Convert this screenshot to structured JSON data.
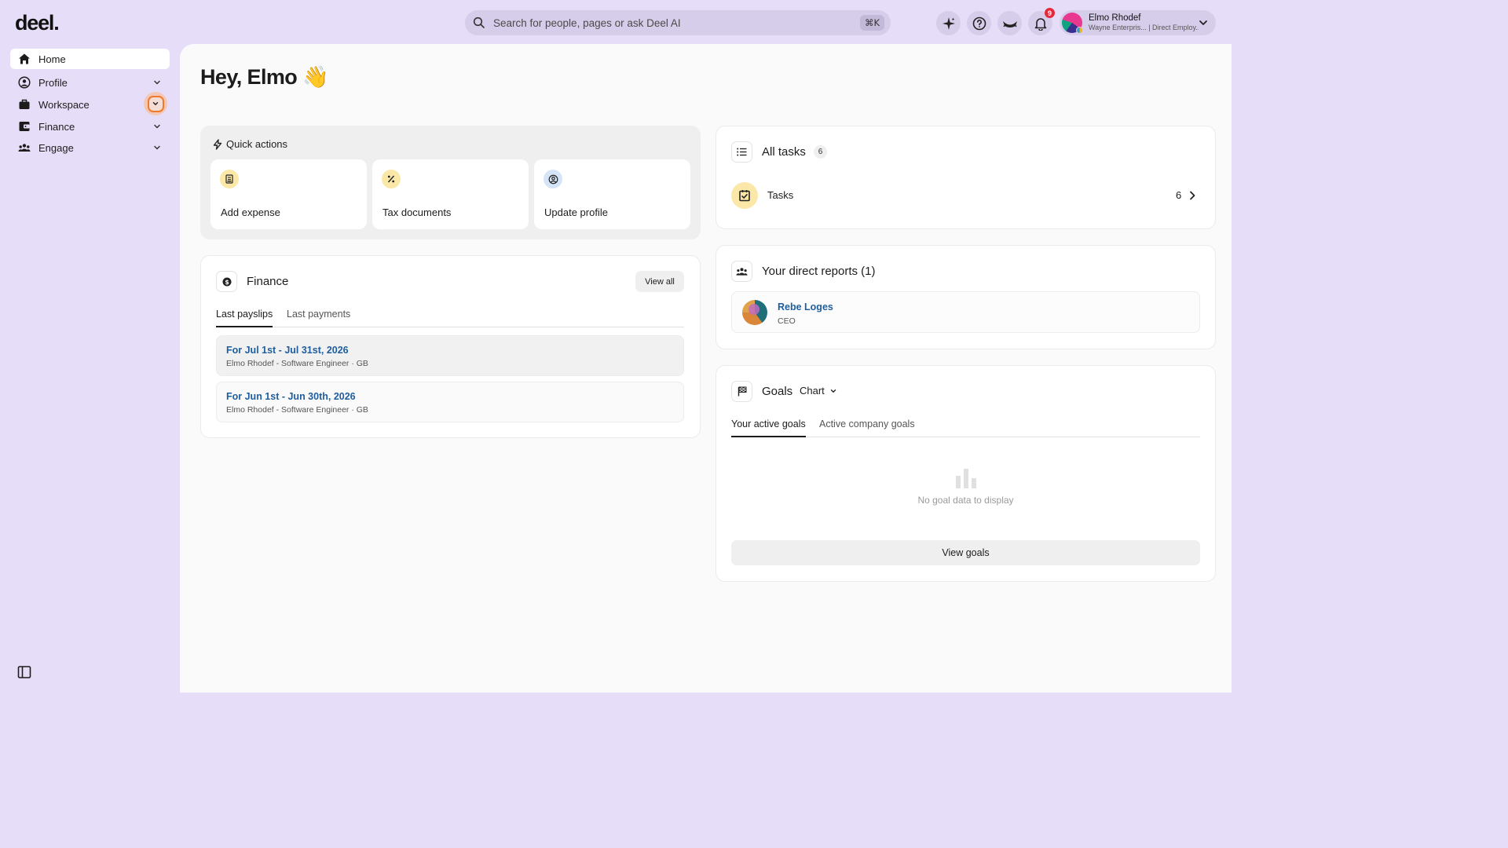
{
  "app": {
    "logo": "deel."
  },
  "search": {
    "placeholder": "Search for people, pages or ask Deel AI",
    "shortcut": "⌘K"
  },
  "topbar": {
    "notification_count": "9"
  },
  "user": {
    "name": "Elmo Rhodef",
    "subtitle": "Wayne Enterpris... | Direct Employ..."
  },
  "sidebar": {
    "items": [
      {
        "label": "Home",
        "icon": "home-icon",
        "active": true
      },
      {
        "label": "Profile",
        "icon": "user-circle-icon"
      },
      {
        "label": "Workspace",
        "icon": "briefcase-icon"
      },
      {
        "label": "Finance",
        "icon": "wallet-icon"
      },
      {
        "label": "Engage",
        "icon": "people-icon"
      }
    ]
  },
  "main": {
    "greeting": "Hey, Elmo",
    "wave": "👋"
  },
  "quick_actions": {
    "title": "Quick actions",
    "items": [
      {
        "label": "Add expense",
        "icon": "receipt-icon",
        "color": "#fbe7a8"
      },
      {
        "label": "Tax documents",
        "icon": "percent-icon",
        "color": "#fbe7a8"
      },
      {
        "label": "Update profile",
        "icon": "user-circle-icon",
        "color": "#d5e4f7"
      }
    ]
  },
  "finance": {
    "title": "Finance",
    "view_all": "View all",
    "tabs": [
      "Last payslips",
      "Last payments"
    ],
    "payslips": [
      {
        "title": "For Jul 1st - Jul 31st, 2026",
        "subtitle": "Elmo Rhodef - Software Engineer · GB"
      },
      {
        "title": "For Jun 1st - Jun 30th, 2026",
        "subtitle": "Elmo Rhodef - Software Engineer · GB"
      }
    ]
  },
  "tasks": {
    "title": "All tasks",
    "count": "6",
    "row_label": "Tasks",
    "row_count": "6"
  },
  "reports": {
    "title": "Your direct reports (1)",
    "people": [
      {
        "name": "Rebe Loges",
        "role": "CEO"
      }
    ]
  },
  "goals": {
    "title": "Goals",
    "view_selector": "Chart",
    "tabs": [
      "Your active goals",
      "Active company goals"
    ],
    "empty_text": "No goal data to display",
    "view_button": "View goals"
  },
  "colors": {
    "accent_bg": "#e6def8",
    "link": "#1f5e9e",
    "badge": "#e5293b",
    "focus_ring": "#f07a2c"
  }
}
